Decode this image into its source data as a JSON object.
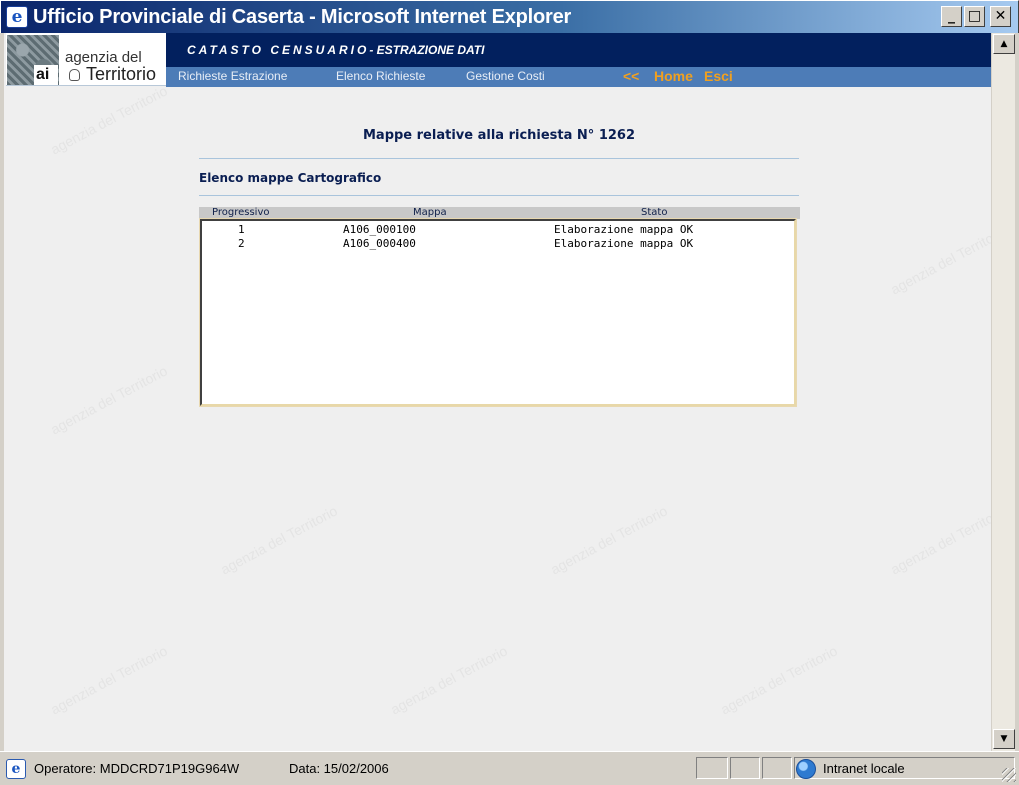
{
  "window": {
    "title": "Ufficio Provinciale di Caserta - Microsoft Internet Explorer",
    "minimize_glyph": "_",
    "maximize_glyph": "□",
    "close_glyph": "✕"
  },
  "header": {
    "logo_line1": "agenzia del",
    "logo_line2": "Territorio",
    "logo_mark": "ai",
    "app_title": "CATASTO CENSUARIO",
    "app_subtitle": "- ESTRAZIONE DATI",
    "nav": {
      "richieste_estrazione": "Richieste Estrazione",
      "elenco_richieste": "Elenco Richieste",
      "gestione_costi": "Gestione Costi",
      "back": "<<",
      "home": "Home",
      "esci": "Esci"
    }
  },
  "main": {
    "heading": "Mappe relative alla richiesta N° 1262",
    "section_title": "Elenco mappe Cartografico",
    "table": {
      "columns": [
        "Progressivo",
        "Mappa",
        "Stato"
      ],
      "rows": [
        {
          "progressivo": "1",
          "mappa": "A106_000100",
          "stato": "Elaborazione mappa OK"
        },
        {
          "progressivo": "2",
          "mappa": "A106_000400",
          "stato": "Elaborazione mappa OK"
        }
      ]
    },
    "watermark_text": "agenzia del Territorio"
  },
  "statusbar": {
    "operatore": "Operatore: MDDCRD71P19G964W",
    "data": "Data: 15/02/2006",
    "zone": "Intranet locale"
  },
  "colors": {
    "header_dark": "#02205e",
    "header_nav": "#4d7cb7",
    "nav_accent": "#f0a020",
    "page_bg": "#efefef"
  },
  "icons": {
    "title": "ie-logo-icon",
    "status": "ie-page-icon",
    "zone": "intranet-globe-icon"
  }
}
